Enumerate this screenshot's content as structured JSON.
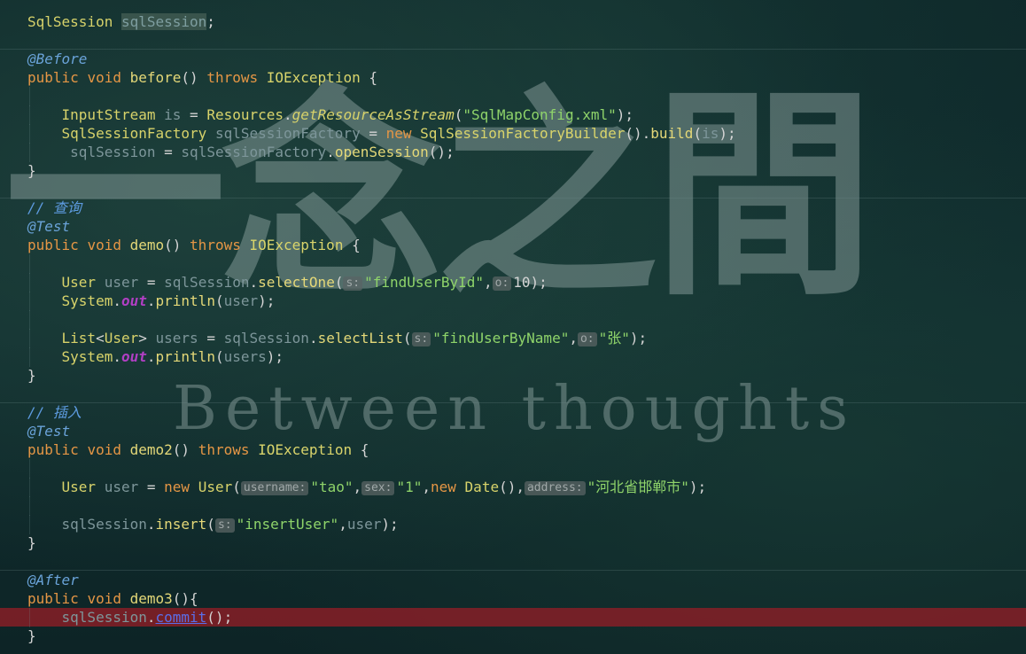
{
  "watermark": {
    "chinese": "一念之間",
    "english": "Between thoughts"
  },
  "code": {
    "l1": {
      "t1": "SqlSession",
      "t2": "sqlSession",
      "t3": ";"
    },
    "before_anno": "@Before",
    "l3": {
      "kw1": "public",
      "kw2": "void",
      "fn": "before",
      "p1": "()",
      "kw3": "throws",
      "cls": "IOException",
      "brace": "{"
    },
    "l5": {
      "type": "InputStream",
      "var": "is",
      "eq": "=",
      "cls": "Resources",
      "dot": ".",
      "fn": "getResourceAsStream",
      "p1": "(",
      "str": "\"SqlMapConfig.xml\"",
      "p2": ");"
    },
    "l6": {
      "type": "SqlSessionFactory",
      "var": "sqlSessionFactory",
      "eq": "=",
      "kw": "new",
      "cls": "SqlSessionFactoryBuilder",
      "p1": "().",
      "fn": "build",
      "p2": "(",
      "arg": "is",
      "p3": ");"
    },
    "l7": {
      "var1": "sqlSession",
      "eq": "=",
      "var2": "sqlSessionFactory",
      "dot": ".",
      "fn": "openSession",
      "p": "();"
    },
    "close_brace": "}",
    "comment_query": "// 查询",
    "test_anno": "@Test",
    "l11": {
      "kw1": "public",
      "kw2": "void",
      "fn": "demo",
      "p1": "()",
      "kw3": "throws",
      "cls": "IOException",
      "brace": "{"
    },
    "l13": {
      "type": "User",
      "var": "user",
      "eq": "=",
      "obj": "sqlSession",
      "dot": ".",
      "fn": "selectOne",
      "p1": "(",
      "hint1": "s:",
      "str": "\"findUserById\"",
      "comma": ",",
      "hint2": "o:",
      "num": "10",
      "p2": ");"
    },
    "l14": {
      "cls": "System",
      "dot1": ".",
      "field": "out",
      "dot2": ".",
      "fn": "println",
      "p1": "(",
      "arg": "user",
      "p2": ");"
    },
    "l16": {
      "type": "List",
      "lt": "<",
      "type2": "User",
      "gt": ">",
      "var": "users",
      "eq": "=",
      "obj": "sqlSession",
      "dot": ".",
      "fn": "selectList",
      "p1": "(",
      "hint1": "s:",
      "str": "\"findUserByName\"",
      "comma": ",",
      "hint2": "o:",
      "str2": "\"张\"",
      "p2": ");"
    },
    "l17": {
      "cls": "System",
      "dot1": ".",
      "field": "out",
      "dot2": ".",
      "fn": "println",
      "p1": "(",
      "arg": "users",
      "p2": ");"
    },
    "comment_insert": "// 插入",
    "l22": {
      "kw1": "public",
      "kw2": "void",
      "fn": "demo2",
      "p1": "()",
      "kw3": "throws",
      "cls": "IOException",
      "brace": "{"
    },
    "l24": {
      "type": "User",
      "var": "user",
      "eq": "=",
      "kw": "new",
      "cls": "User",
      "p1": "(",
      "hint1": "username:",
      "str1": "\"tao\"",
      "c1": ",",
      "hint2": "sex:",
      "str2": "\"1\"",
      "c2": ",",
      "kw2": "new",
      "cls2": "Date",
      "p2": "(),",
      "hint3": "address:",
      "str3": "\"河北省邯郸市\"",
      "p3": ");"
    },
    "l26": {
      "obj": "sqlSession",
      "dot": ".",
      "fn": "insert",
      "p1": "(",
      "hint1": "s:",
      "str": "\"insertUser\"",
      "comma": ",",
      "arg": "user",
      "p2": ");"
    },
    "after_anno": "@After",
    "l30": {
      "kw1": "public",
      "kw2": "void",
      "fn": "demo3",
      "p1": "(){"
    },
    "l31": {
      "obj": "sqlSession",
      "dot": ".",
      "fn": "commit",
      "p": "();"
    }
  }
}
